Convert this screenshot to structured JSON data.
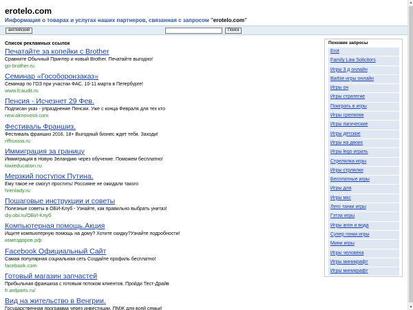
{
  "header": {
    "site_title": "erotelo.com",
    "subtitle_prefix": "Информация о товарах и услугах наших партнеров, связанная с запросом \"",
    "subtitle_query": "erotelo.com",
    "subtitle_suffix": "\""
  },
  "search": {
    "language_button": "английский",
    "input_value": "",
    "search_button": "Поиск"
  },
  "ads": {
    "heading": "Список рекламных ссылок",
    "items": [
      {
        "title": "Печатайте за копейки с Brother",
        "desc": "Сравните Обычный Принтер и новый Brother. Печатайте выгодно!",
        "url": "go-brother.ru"
      },
      {
        "title": "Семинар «Гособоронзаказ»",
        "desc": "Семинар по ГОЗ при участии ФАС. 10-11 марта в Петербурге!",
        "url": "www.fcaudit.ru"
      },
      {
        "title": "Пенсия - Исчезнет 29 Фев.",
        "desc": "Подписан указ - упразднение Пенсии. Уже с конца Февраля для тех кто",
        "url": "new.oknovosti.com"
      },
      {
        "title": "Фестиваль Франшиз.",
        "desc": "Фестиваль франшиз 2016. 18+ Выгодный бизнес ждет тебя. Заходи!",
        "url": "riffrussia.ru"
      },
      {
        "title": "Иммиграция за границу",
        "desc": "Иммиграция в Новую Зеландию через обучение. Поможем бесплатно!",
        "url": "kiwieducation.ru"
      },
      {
        "title": "Мерзкий поступок Путина.",
        "desc": "Ему такое не смогут простить! Россияне не ожидали такого",
        "url": "hrenlady.ru"
      },
      {
        "title": "Пошаговые инструкции и советы",
        "desc": "Полезные советы в ОБИ-Клуб - Узнайте, как правильно выбрать унитаз!",
        "url": "diy.obi.ru/ОБИ-Клуб"
      },
      {
        "title": "Компьютерная помощь.Акция",
        "desc": "Ищите компьютерную помощь на дому? Хотите скидку?Узнайте подробности!",
        "url": "компздоров.рф"
      },
      {
        "title": "Facebook Официальный Сайт",
        "desc": "Самая популярная социальная сеть Создайте профиль бесплатно!",
        "url": "facebook.com"
      },
      {
        "title": "Готовый магазин запчастей",
        "desc": "Прибыльная франшиза с готовым потоком клиентов. Пройди Тест-Драйв",
        "url": "fr.ardparts.ru/"
      },
      {
        "title": "Вид на жительство в Венгрии.",
        "desc": "Государственная программа через инвестиции. ПМЖ для всей семьи!",
        "url": "voldangroup.com"
      }
    ]
  },
  "related": {
    "heading": "Похожие запросы",
    "items": [
      "Erot",
      "Family Law Solicitors",
      "Игры 3 д онлайн",
      "Barbie игры онлайн",
      "Игры он",
      "Игры стратегие",
      "Поиграть в игры",
      "Игры срелялки",
      "Игры пагические",
      "Игры детские",
      "Игры на двоих",
      "Игры lego играть",
      "Стрелялка игры",
      "Игры стрлялки",
      "Бесплатные игры",
      "Игры для",
      "Игры мкс",
      "Лего танки игры",
      "Гэтэа игры",
      "Игры агон и вода",
      "Супер гонки игры",
      "Мини игры",
      "Игры человека",
      "Игры миникрафт",
      "Игры миникрафт"
    ]
  }
}
